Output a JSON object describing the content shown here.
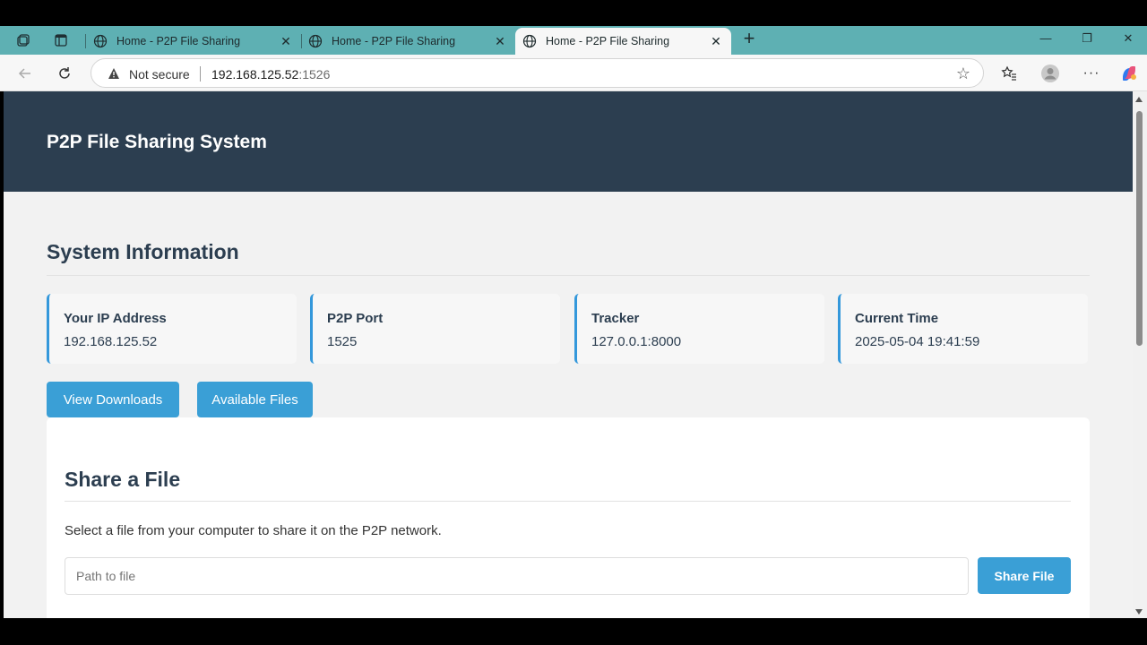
{
  "browser": {
    "tabs": [
      {
        "title": "Home - P2P File Sharing",
        "close": "✕"
      },
      {
        "title": "Home - P2P File Sharing",
        "close": "✕"
      },
      {
        "title": "Home - P2P File Sharing",
        "close": "✕"
      }
    ],
    "active_tab": 2,
    "new_tab": "+",
    "window": {
      "minimize": "—",
      "restore": "❐",
      "close": "✕"
    },
    "address": {
      "security": "Not secure",
      "host": "192.168.125.52",
      "port": ":1526"
    }
  },
  "page": {
    "header_title": "P2P File Sharing System",
    "system_info": {
      "title": "System Information",
      "cards": [
        {
          "label": "Your IP Address",
          "value": "192.168.125.52"
        },
        {
          "label": "P2P Port",
          "value": "1525"
        },
        {
          "label": "Tracker",
          "value": "127.0.0.1:8000"
        },
        {
          "label": "Current Time",
          "value": "2025-05-04 19:41:59"
        }
      ]
    },
    "buttons": {
      "view_downloads": "View Downloads",
      "available_files": "Available Files"
    },
    "share": {
      "title": "Share a File",
      "description": "Select a file from your computer to share it on the P2P network.",
      "input_placeholder": "Path to file",
      "button": "Share File"
    }
  },
  "colors": {
    "header_bg": "#2c3e50",
    "accent": "#3498db",
    "button": "#3a9fd6",
    "tabstrip": "#5eb0b3"
  }
}
